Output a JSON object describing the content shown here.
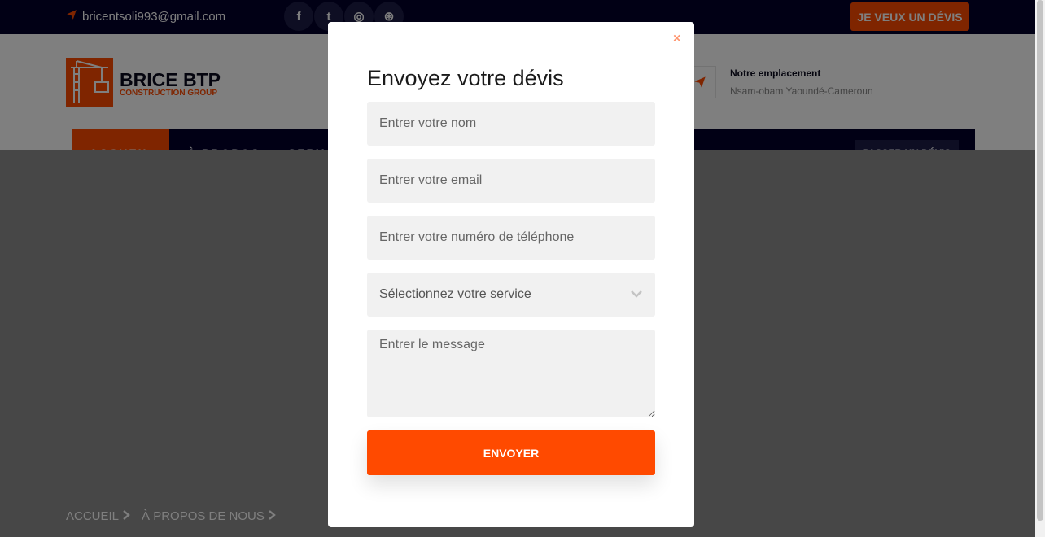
{
  "topbar": {
    "email": "bricentsoli993@gmail.com",
    "social": [
      {
        "name": "facebook-icon",
        "glyph": "f"
      },
      {
        "name": "twitter-icon",
        "glyph": "t"
      },
      {
        "name": "instagram-icon",
        "glyph": "◎"
      },
      {
        "name": "dribbble-icon",
        "glyph": "⊛"
      }
    ],
    "cta": "JE VEUX UN DÉVIS"
  },
  "header": {
    "brand": "BRICE BTP",
    "tagline": "CONSTRUCTION GROUP",
    "location_title": "Notre emplacement",
    "location_text": "Nsam-obam Yaoundé-Cameroun"
  },
  "nav": {
    "items": [
      "ACCUEIL",
      "À PROPOS",
      "SERV"
    ],
    "cta": "PASSER UN DÉVIS"
  },
  "breadcrumb": {
    "items": [
      "ACCUEIL",
      "À PROPOS DE NOUS"
    ]
  },
  "modal": {
    "title": "Envoyez votre dévis",
    "name_placeholder": "Entrer votre nom",
    "email_placeholder": "Entrer votre email",
    "phone_placeholder": "Entrer votre numéro de téléphone",
    "service_placeholder": "Sélectionnez votre service",
    "message_placeholder": "Entrer le message",
    "submit": "ENVOYER",
    "close": "×"
  },
  "colors": {
    "accent": "#ff4a00",
    "navy": "#03002a"
  }
}
